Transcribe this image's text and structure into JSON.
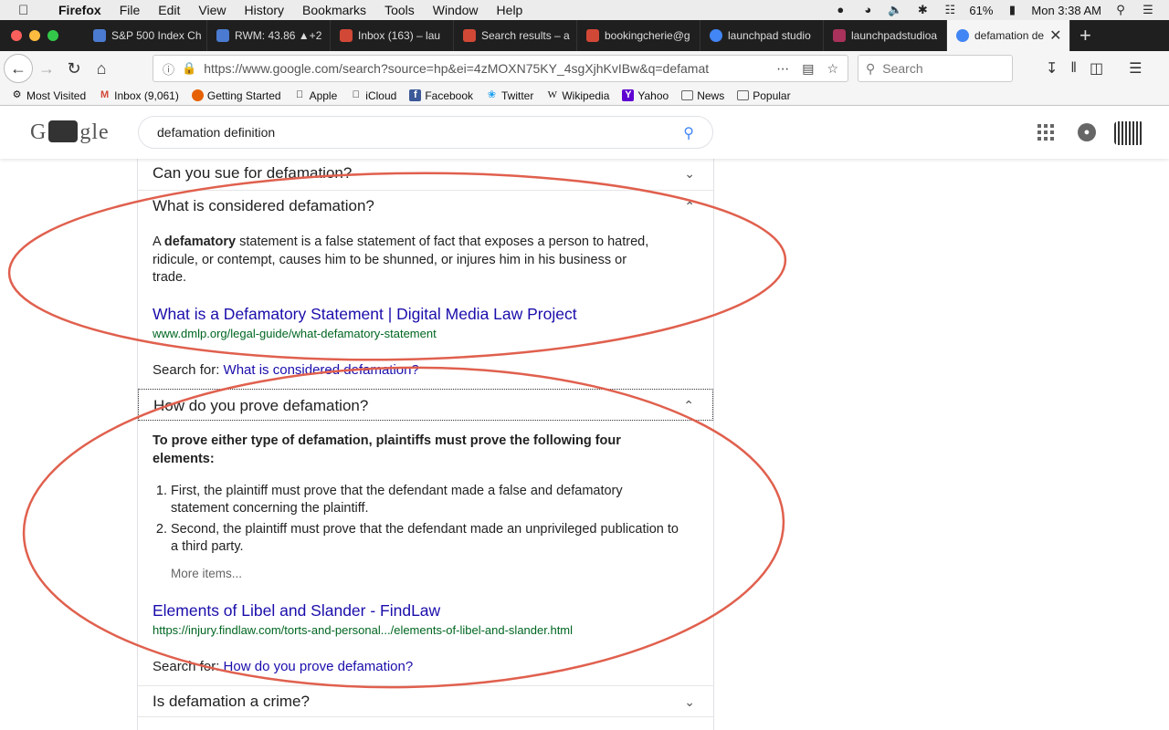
{
  "menubar": {
    "app": "Firefox",
    "items": [
      "File",
      "Edit",
      "View",
      "History",
      "Bookmarks",
      "Tools",
      "Window",
      "Help"
    ],
    "battery": "61%",
    "clock": "Mon 3:38 AM"
  },
  "tabs": [
    {
      "label": "S&P 500 Index Ch",
      "fav_color": "#4a7bd0"
    },
    {
      "label": "RWM: 43.86 ▲+2",
      "fav_color": "#4a7bd0"
    },
    {
      "label": "Inbox (163) – lau",
      "fav_color": "#d14836"
    },
    {
      "label": "Search results – a",
      "fav_color": "#d14836"
    },
    {
      "label": "bookingcherie@g",
      "fav_color": "#d14836"
    },
    {
      "label": "launchpad studio",
      "fav_color": "#4285f4"
    },
    {
      "label": "launchpadstudioa",
      "fav_color": "#a8325b"
    },
    {
      "label": "defamation de",
      "fav_color": "#4285f4",
      "active": true
    }
  ],
  "navbar": {
    "url": "https://www.google.com/search?source=hp&ei=4zMOXN75KY_4sgXjhKvIBw&q=defamat",
    "search_placeholder": "Search"
  },
  "bookmarks": [
    {
      "label": "Most Visited",
      "icon": "gear-icon"
    },
    {
      "label": "Inbox (9,061)",
      "icon": "gmail-icon"
    },
    {
      "label": "Getting Started",
      "icon": "firefox-icon"
    },
    {
      "label": "Apple",
      "icon": "apple-icon"
    },
    {
      "label": "iCloud",
      "icon": "apple-icon"
    },
    {
      "label": "Facebook",
      "icon": "facebook-icon"
    },
    {
      "label": "Twitter",
      "icon": "twitter-icon"
    },
    {
      "label": "Wikipedia",
      "icon": "wikipedia-icon"
    },
    {
      "label": "Yahoo",
      "icon": "yahoo-icon"
    },
    {
      "label": "News",
      "icon": "folder-icon"
    },
    {
      "label": "Popular",
      "icon": "folder-icon"
    }
  ],
  "google": {
    "logo_left": "G",
    "logo_right": "gle",
    "query": "defamation definition"
  },
  "results": {
    "q1": "Can you sue for defamation?",
    "q2": "What is considered defamation?",
    "a2_pre": "A ",
    "a2_bold": "defamatory",
    "a2_post": " statement is a false statement of fact that exposes a person to hatred, ridicule, or contempt, causes him to be shunned, or injures him in his business or trade.",
    "a2_link": "What is a Defamatory Statement | Digital Media Law Project",
    "a2_url": "www.dmlp.org/legal-guide/what-defamatory-statement",
    "a2_search_prefix": "Search for: ",
    "a2_search_link": "What is considered defamation?",
    "q3": "How do you prove defamation?",
    "a3_heading": "To prove either type of defamation, plaintiffs must prove the following four elements:",
    "a3_steps": [
      "First, the plaintiff must prove that the defendant made a false and defamatory statement concerning the plaintiff.",
      "Second, the plaintiff must prove that the defendant made an unprivileged publication to a third party."
    ],
    "a3_more": "More items...",
    "a3_link": "Elements of Libel and Slander - FindLaw",
    "a3_url": "https://injury.findlaw.com/torts-and-personal.../elements-of-libel-and-slander.html",
    "a3_search_prefix": "Search for: ",
    "a3_search_link": "How do you prove defamation?",
    "q4": "Is defamation a crime?"
  },
  "annotation_color": "#e0604e"
}
